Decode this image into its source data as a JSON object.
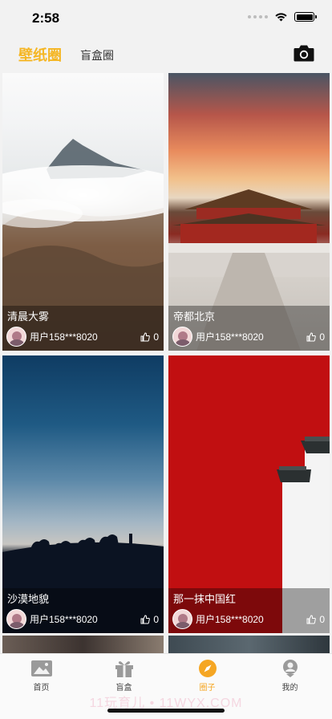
{
  "status": {
    "time": "2:58"
  },
  "header": {
    "tab_active": "壁纸圈",
    "tab_inactive": "盲盒圈",
    "camera_icon": "camera-icon"
  },
  "cards": [
    {
      "title": "清晨大雾",
      "user": "用户158***8020",
      "likes": "0"
    },
    {
      "title": "帝都北京",
      "user": "用户158***8020",
      "likes": "0"
    },
    {
      "title": "沙漠地貌",
      "user": "用户158***8020",
      "likes": "0"
    },
    {
      "title": "那一抹中国红",
      "user": "用户158***8020",
      "likes": "0"
    }
  ],
  "tabbar": {
    "items": [
      {
        "label": "首页",
        "icon": "picture-icon"
      },
      {
        "label": "盲盒",
        "icon": "gift-icon"
      },
      {
        "label": "圈子",
        "icon": "compass-icon"
      },
      {
        "label": "我的",
        "icon": "profile-icon"
      }
    ],
    "active_color": "#f5a623"
  },
  "watermark": "11玩育儿 • 11WYX.COM",
  "colors": {
    "accent": "#f5b623"
  }
}
